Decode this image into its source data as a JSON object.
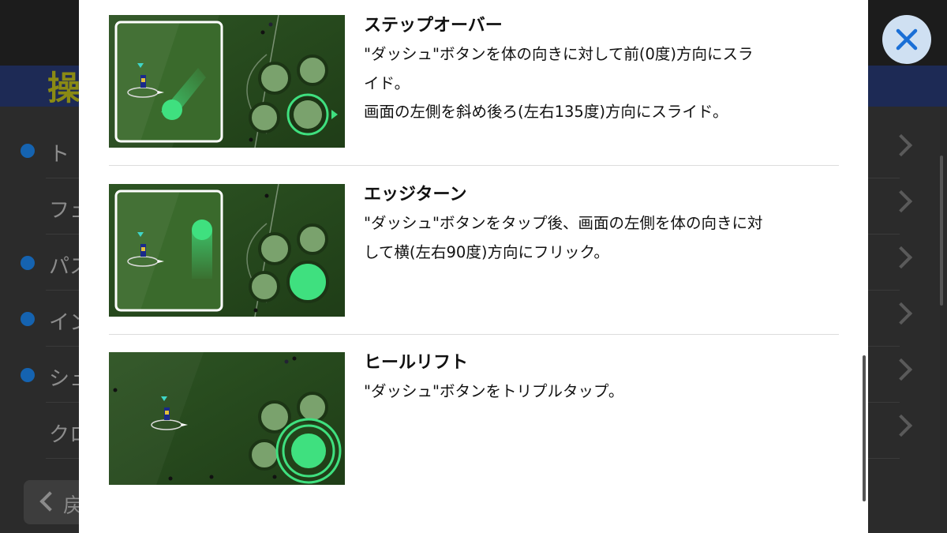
{
  "background": {
    "title_char": "操",
    "list": [
      {
        "label": "ト",
        "bullet": true
      },
      {
        "label": "フェ",
        "bullet": false
      },
      {
        "label": "パス",
        "bullet": true
      },
      {
        "label": "イン",
        "bullet": true
      },
      {
        "label": "シュ",
        "bullet": true
      },
      {
        "label": "クロ",
        "bullet": false
      }
    ],
    "back_label": "戻"
  },
  "close_button": {
    "icon": "close-icon",
    "color": "#1a6fd6"
  },
  "items": [
    {
      "title": "ステップオーバー",
      "lines": [
        "\"ダッシュ\"ボタンを体の向きに対して前(0度)方向にスラ",
        "イド。",
        "画面の左側を斜め後ろ(左右135度)方向にスライド。"
      ],
      "thumb_icon": "step-over-gesture-illustration"
    },
    {
      "title": "エッジターン",
      "lines": [
        "\"ダッシュ\"ボタンをタップ後、画面の左側を体の向きに対",
        "して横(左右90度)方向にフリック。"
      ],
      "thumb_icon": "edge-turn-gesture-illustration"
    },
    {
      "title": "ヒールリフト",
      "lines": [
        "\"ダッシュ\"ボタンをトリプルタップ。"
      ],
      "thumb_icon": "heel-lift-gesture-illustration"
    }
  ],
  "colors": {
    "accent_green": "#3fe07f",
    "pitch": "#274a1c",
    "modal_bg": "#ffffff"
  }
}
